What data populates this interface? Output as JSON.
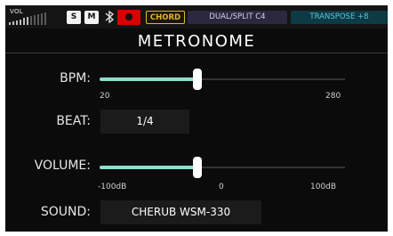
{
  "status_bar": {
    "vol_label": "VOL",
    "vol_level": 0.5,
    "s_label": "S",
    "m_label": "M",
    "bluetooth_icon": "bluetooth-icon",
    "record_icon": "record-icon",
    "chord_label": "CHORD",
    "dual_split_label": "DUAL/SPLIT",
    "dual_split_value": "C4",
    "transpose_label": "TRANSPOSE",
    "transpose_value": "+8"
  },
  "title": "METRONOME",
  "bpm": {
    "label": "BPM:",
    "min_label": "20",
    "max_label": "280",
    "level": 0.4
  },
  "beat": {
    "label": "BEAT:",
    "value": "1/4"
  },
  "volume": {
    "label": "VOLUME:",
    "min_label": "-100dB",
    "mid_label": "0",
    "max_label": "100dB",
    "level": 0.4
  },
  "sound": {
    "label": "SOUND:",
    "value": "CHERUB WSM-330"
  },
  "colors": {
    "slider_fill": "#8de0cd",
    "chord_accent": "#e1b43a",
    "transpose_accent": "#58c7d8",
    "record": "#d80000"
  }
}
